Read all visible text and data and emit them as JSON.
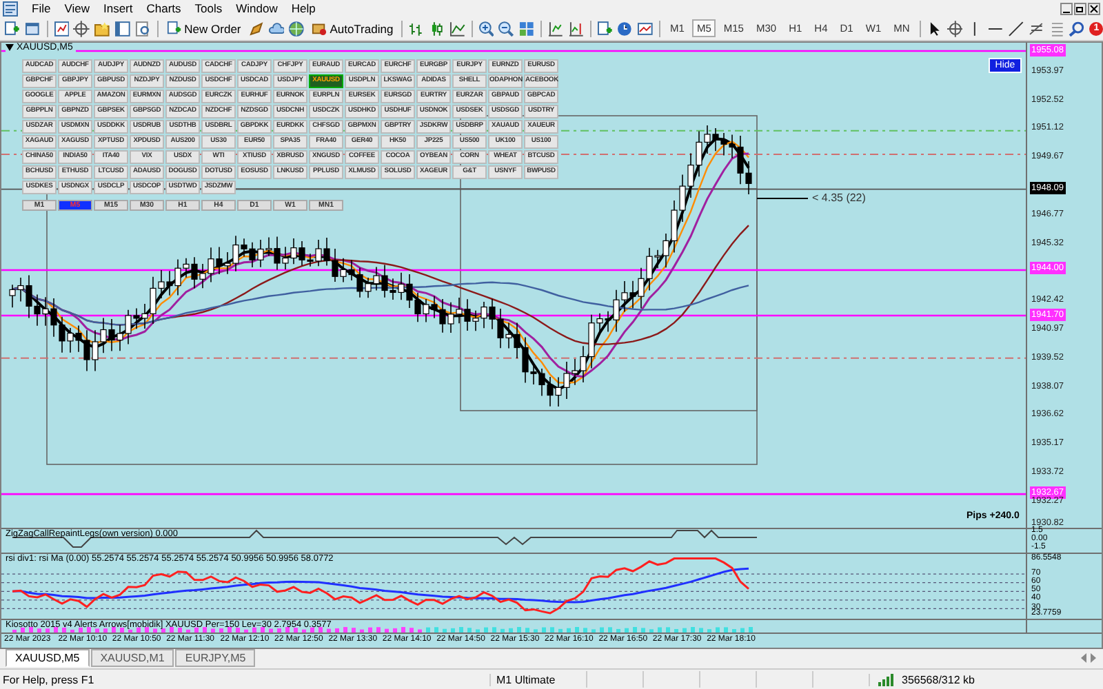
{
  "menu": [
    "File",
    "View",
    "Insert",
    "Charts",
    "Tools",
    "Window",
    "Help"
  ],
  "toolbar": {
    "new_order": "New Order",
    "autotrading": "AutoTrading",
    "notifications": "1",
    "timeframes": [
      {
        "label": "M1",
        "selected": false
      },
      {
        "label": "M5",
        "selected": true
      },
      {
        "label": "M15",
        "selected": false
      },
      {
        "label": "M30",
        "selected": false
      },
      {
        "label": "H1",
        "selected": false
      },
      {
        "label": "H4",
        "selected": false
      },
      {
        "label": "D1",
        "selected": false
      },
      {
        "label": "W1",
        "selected": false
      },
      {
        "label": "MN",
        "selected": false
      }
    ]
  },
  "chart": {
    "title": "XAUUSD,M5",
    "hide_button": "Hide",
    "measure_label": "< 4.35 (22)",
    "pips_label": "Pips +240.0",
    "symbol_rows": [
      [
        {
          "label": "AUDCAD",
          "selected": false
        },
        {
          "label": "AUDCHF",
          "selected": false
        },
        {
          "label": "AUDJPY",
          "selected": false
        },
        {
          "label": "AUDNZD",
          "selected": false
        },
        {
          "label": "AUDUSD",
          "selected": false
        },
        {
          "label": "CADCHF",
          "selected": false
        },
        {
          "label": "CADJPY",
          "selected": false
        },
        {
          "label": "CHFJPY",
          "selected": false
        },
        {
          "label": "EURAUD",
          "selected": false
        },
        {
          "label": "EURCAD",
          "selected": false
        },
        {
          "label": "EURCHF",
          "selected": false
        },
        {
          "label": "EURGBP",
          "selected": false
        },
        {
          "label": "EURJPY",
          "selected": false
        },
        {
          "label": "EURNZD",
          "selected": false
        },
        {
          "label": "EURUSD",
          "selected": false
        }
      ],
      [
        {
          "label": "GBPCHF",
          "selected": false
        },
        {
          "label": "GBPJPY",
          "selected": false
        },
        {
          "label": "GBPUSD",
          "selected": false
        },
        {
          "label": "NZDJPY",
          "selected": false
        },
        {
          "label": "NZDUSD",
          "selected": false
        },
        {
          "label": "USDCHF",
          "selected": false
        },
        {
          "label": "USDCAD",
          "selected": false
        },
        {
          "label": "USDJPY",
          "selected": false
        },
        {
          "label": "XAUUSD",
          "selected": true
        },
        {
          "label": "USDPLN",
          "selected": false
        },
        {
          "label": "LKSWAG",
          "selected": false
        },
        {
          "label": "ADIDAS",
          "selected": false
        },
        {
          "label": "SHELL",
          "selected": false
        },
        {
          "label": "ODAPHON",
          "selected": false
        },
        {
          "label": "ACEBOOK",
          "selected": false
        }
      ],
      [
        {
          "label": "GOOGLE",
          "selected": false
        },
        {
          "label": "APPLE",
          "selected": false
        },
        {
          "label": "AMAZON",
          "selected": false
        },
        {
          "label": "EURMXN",
          "selected": false
        },
        {
          "label": "AUDSGD",
          "selected": false
        },
        {
          "label": "EURCZK",
          "selected": false
        },
        {
          "label": "EURHUF",
          "selected": false
        },
        {
          "label": "EURNOK",
          "selected": false
        },
        {
          "label": "EURPLN",
          "selected": false
        },
        {
          "label": "EURSEK",
          "selected": false
        },
        {
          "label": "EURSGD",
          "selected": false
        },
        {
          "label": "EURTRY",
          "selected": false
        },
        {
          "label": "EURZAR",
          "selected": false
        },
        {
          "label": "GBPAUD",
          "selected": false
        },
        {
          "label": "GBPCAD",
          "selected": false
        }
      ],
      [
        {
          "label": "GBPPLN",
          "selected": false
        },
        {
          "label": "GBPNZD",
          "selected": false
        },
        {
          "label": "GBPSEK",
          "selected": false
        },
        {
          "label": "GBPSGD",
          "selected": false
        },
        {
          "label": "NZDCAD",
          "selected": false
        },
        {
          "label": "NZDCHF",
          "selected": false
        },
        {
          "label": "NZDSGD",
          "selected": false
        },
        {
          "label": "USDCNH",
          "selected": false
        },
        {
          "label": "USDCZK",
          "selected": false
        },
        {
          "label": "USDHKD",
          "selected": false
        },
        {
          "label": "USDHUF",
          "selected": false
        },
        {
          "label": "USDNOK",
          "selected": false
        },
        {
          "label": "USDSEK",
          "selected": false
        },
        {
          "label": "USDSGD",
          "selected": false
        },
        {
          "label": "USDTRY",
          "selected": false
        }
      ],
      [
        {
          "label": "USDZAR",
          "selected": false
        },
        {
          "label": "USDMXN",
          "selected": false
        },
        {
          "label": "USDDKK",
          "selected": false
        },
        {
          "label": "USDRUB",
          "selected": false
        },
        {
          "label": "USDTHB",
          "selected": false
        },
        {
          "label": "USDBRL",
          "selected": false
        },
        {
          "label": "GBPDKK",
          "selected": false
        },
        {
          "label": "EURDKK",
          "selected": false
        },
        {
          "label": "CHFSGD",
          "selected": false
        },
        {
          "label": "GBPMXN",
          "selected": false
        },
        {
          "label": "GBPTRY",
          "selected": false
        },
        {
          "label": "JSDKRW",
          "selected": false
        },
        {
          "label": "USDBRP",
          "selected": false
        },
        {
          "label": "XAUAUD",
          "selected": false
        },
        {
          "label": "XAUEUR",
          "selected": false
        }
      ],
      [
        {
          "label": "XAGAUD",
          "selected": false
        },
        {
          "label": "XAGUSD",
          "selected": false
        },
        {
          "label": "XPTUSD",
          "selected": false
        },
        {
          "label": "XPDUSD",
          "selected": false
        },
        {
          "label": "AUS200",
          "selected": false
        },
        {
          "label": "US30",
          "selected": false
        },
        {
          "label": "EUR50",
          "selected": false
        },
        {
          "label": "SPA35",
          "selected": false
        },
        {
          "label": "FRA40",
          "selected": false
        },
        {
          "label": "GER40",
          "selected": false
        },
        {
          "label": "HK50",
          "selected": false
        },
        {
          "label": "JP225",
          "selected": false
        },
        {
          "label": "US500",
          "selected": false
        },
        {
          "label": "UK100",
          "selected": false
        },
        {
          "label": "US100",
          "selected": false
        }
      ],
      [
        {
          "label": "CHINA50",
          "selected": false
        },
        {
          "label": "INDIA50",
          "selected": false
        },
        {
          "label": "ITA40",
          "selected": false
        },
        {
          "label": "VIX",
          "selected": false
        },
        {
          "label": "USDX",
          "selected": false
        },
        {
          "label": "WTI",
          "selected": false
        },
        {
          "label": "XTIUSD",
          "selected": false
        },
        {
          "label": "XBRUSD",
          "selected": false
        },
        {
          "label": "XNGUSD",
          "selected": false
        },
        {
          "label": "COFFEE",
          "selected": false
        },
        {
          "label": "COCOA",
          "selected": false
        },
        {
          "label": "OYBEAN",
          "selected": false
        },
        {
          "label": "CORN",
          "selected": false
        },
        {
          "label": "WHEAT",
          "selected": false
        },
        {
          "label": "BTCUSD",
          "selected": false
        }
      ],
      [
        {
          "label": "BCHUSD",
          "selected": false
        },
        {
          "label": "ETHUSD",
          "selected": false
        },
        {
          "label": "LTCUSD",
          "selected": false
        },
        {
          "label": "ADAUSD",
          "selected": false
        },
        {
          "label": "DOGUSD",
          "selected": false
        },
        {
          "label": "DOTUSD",
          "selected": false
        },
        {
          "label": "EOSUSD",
          "selected": false
        },
        {
          "label": "LNKUSD",
          "selected": false
        },
        {
          "label": "PPLUSD",
          "selected": false
        },
        {
          "label": "XLMUSD",
          "selected": false
        },
        {
          "label": "SOLUSD",
          "selected": false
        },
        {
          "label": "XAGEUR",
          "selected": false
        },
        {
          "label": "G&T",
          "selected": false
        },
        {
          "label": "USNYF",
          "selected": false
        },
        {
          "label": "BWPUSD",
          "selected": false
        }
      ],
      [
        {
          "label": "USDKES",
          "selected": false
        },
        {
          "label": "USDNGX",
          "selected": false
        },
        {
          "label": "USDCLP",
          "selected": false
        },
        {
          "label": "USDCOP",
          "selected": false
        },
        {
          "label": "USDTWD",
          "selected": false
        },
        {
          "label": "JSDZMW",
          "selected": false
        }
      ]
    ],
    "timeframe_buttons": [
      {
        "label": "M1",
        "selected": false
      },
      {
        "label": "M5",
        "selected": true
      },
      {
        "label": "M15",
        "selected": false
      },
      {
        "label": "M30",
        "selected": false
      },
      {
        "label": "H1",
        "selected": false
      },
      {
        "label": "H4",
        "selected": false
      },
      {
        "label": "D1",
        "selected": false
      },
      {
        "label": "W1",
        "selected": false
      },
      {
        "label": "MN1",
        "selected": false
      }
    ],
    "price_labels": [
      {
        "text": "1955.08",
        "kind": "line"
      },
      {
        "text": "1953.97",
        "kind": "plain"
      },
      {
        "text": "1952.52",
        "kind": "plain"
      },
      {
        "text": "1951.12",
        "kind": "plain"
      },
      {
        "text": "1949.67",
        "kind": "plain"
      },
      {
        "text": "1948.09",
        "kind": "current"
      },
      {
        "text": "1946.77",
        "kind": "plain"
      },
      {
        "text": "1945.32",
        "kind": "plain"
      },
      {
        "text": "1944.00",
        "kind": "line"
      },
      {
        "text": "1942.42",
        "kind": "plain"
      },
      {
        "text": "1941.70",
        "kind": "line"
      },
      {
        "text": "1940.97",
        "kind": "plain"
      },
      {
        "text": "1939.52",
        "kind": "plain"
      },
      {
        "text": "1938.07",
        "kind": "plain"
      },
      {
        "text": "1936.62",
        "kind": "plain"
      },
      {
        "text": "1935.17",
        "kind": "plain"
      },
      {
        "text": "1933.72",
        "kind": "plain"
      },
      {
        "text": "1932.67",
        "kind": "line"
      },
      {
        "text": "1932.27",
        "kind": "plain"
      },
      {
        "text": "1930.82",
        "kind": "plain"
      }
    ]
  },
  "zigzag": {
    "title": "ZigZagCallRepaintLegs(own version) 0.000",
    "axis": [
      "1.5",
      "0.00",
      "-1.5"
    ]
  },
  "rsi": {
    "title": "rsi div1: rsi Ma (0.00) 55.2574 55.2574 55.2574 55.2574 50.9956 50.9956 58.0772",
    "axis": [
      "86.5548",
      "70",
      "60",
      "50",
      "40",
      "30",
      "23.7759"
    ]
  },
  "kiosotto": {
    "title": "Kiosotto 2015 v4 Alerts Arrows[mobidik] XAUUSD Per=150 Lev=30 2.7954 0.3577"
  },
  "time_axis": [
    "22 Mar 2023",
    "22 Mar 10:10",
    "22 Mar 10:50",
    "22 Mar 11:30",
    "22 Mar 12:10",
    "22 Mar 12:50",
    "22 Mar 13:30",
    "22 Mar 14:10",
    "22 Mar 14:50",
    "22 Mar 15:30",
    "22 Mar 16:10",
    "22 Mar 16:50",
    "22 Mar 17:30",
    "22 Mar 18:10"
  ],
  "tabs": [
    {
      "label": "XAUUSD,M5",
      "selected": true
    },
    {
      "label": "XAUUSD,M1",
      "selected": false
    },
    {
      "label": "EURJPY,M5",
      "selected": false
    }
  ],
  "status_bar": {
    "help": "For Help, press F1",
    "profile": "M1 Ultimate",
    "traffic": "356568/312 kb"
  }
}
